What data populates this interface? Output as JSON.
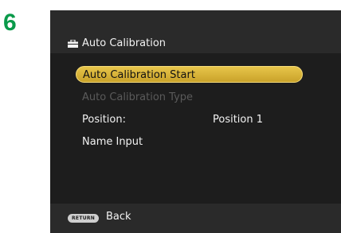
{
  "step_number": "6",
  "screen": {
    "title": "Auto Calibration",
    "title_icon": "toolbox-icon",
    "menu": {
      "auto_calibration_start": "Auto Calibration Start",
      "auto_calibration_type": "Auto Calibration Type",
      "position_label": "Position:",
      "position_value": "Position 1",
      "name_input": "Name Input"
    },
    "footer": {
      "return_button": "RETURN",
      "back_label": "Back"
    }
  },
  "colors": {
    "highlight": "#d9b53a",
    "step_number": "#0a9a4a",
    "background": "#1d1d1d"
  }
}
